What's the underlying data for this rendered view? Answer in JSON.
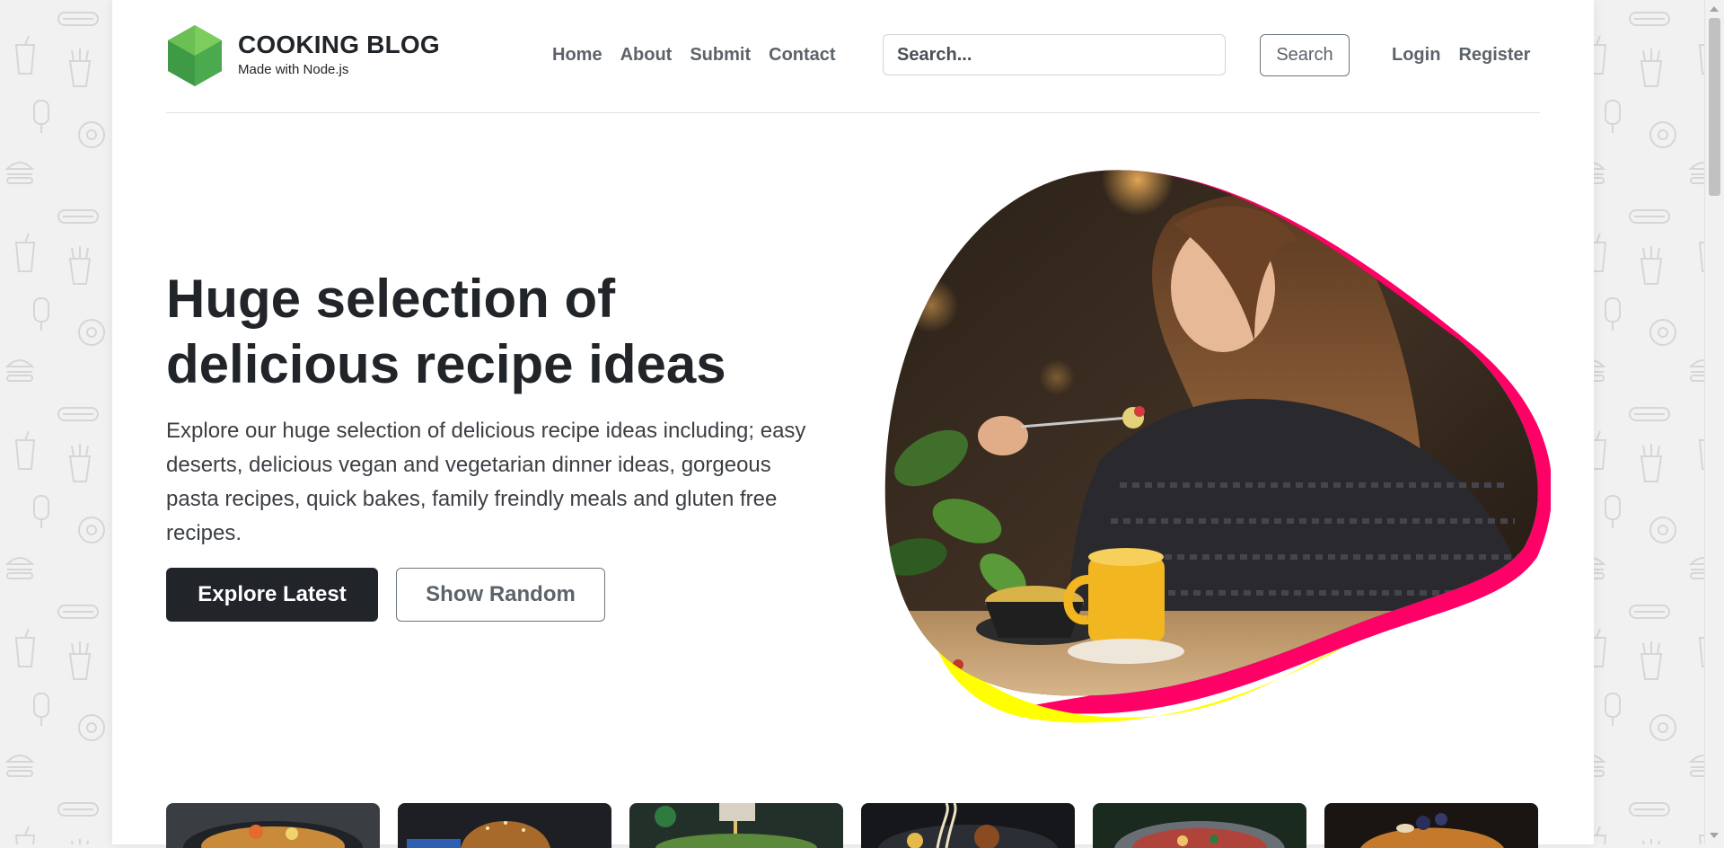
{
  "brand": {
    "title": "COOKING BLOG",
    "subtitle": "Made with Node.js",
    "logo_icon": "green-hexagon-logo-icon"
  },
  "nav": {
    "items": [
      {
        "label": "Home"
      },
      {
        "label": "About"
      },
      {
        "label": "Submit"
      },
      {
        "label": "Contact"
      }
    ]
  },
  "search": {
    "placeholder": "Search...",
    "button_label": "Search"
  },
  "auth": {
    "login": "Login",
    "register": "Register"
  },
  "hero": {
    "title": "Huge selection of delicious recipe ideas",
    "text": "Explore our huge selection of delicious recipe ideas including; easy deserts, delicious vegan and vegetarian dinner ideas, gorgeous pasta recipes, quick bakes, family freindly meals and gluten free recipes.",
    "primary_button": "Explore Latest",
    "secondary_button": "Show Random",
    "image": "woman-eating-pasta-photo"
  },
  "categories": [
    {
      "image": "ramen-bowl-photo"
    },
    {
      "image": "burger-photo"
    },
    {
      "image": "salad-dressing-photo"
    },
    {
      "image": "noodles-photo"
    },
    {
      "image": "stew-pot-photo"
    },
    {
      "image": "french-toast-photo"
    }
  ],
  "colors": {
    "accent_pink": "#ff0066",
    "accent_yellow": "#ffff00",
    "dark_button": "#212529",
    "logo_green": "#5cb85c"
  }
}
